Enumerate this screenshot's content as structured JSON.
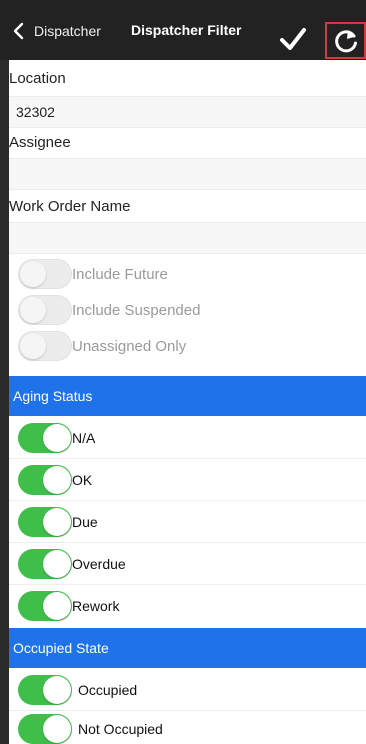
{
  "header": {
    "back_label": "Dispatcher",
    "title": "Dispatcher Filter"
  },
  "form": {
    "location": {
      "label": "Location",
      "value": "32302"
    },
    "assignee": {
      "label": "Assignee",
      "value": ""
    },
    "work_order_name": {
      "label": "Work Order Name",
      "value": ""
    }
  },
  "options": [
    {
      "label": "Include Future",
      "on": false
    },
    {
      "label": "Include Suspended",
      "on": false
    },
    {
      "label": "Unassigned Only",
      "on": false
    }
  ],
  "aging_status": {
    "title": "Aging Status",
    "items": [
      {
        "label": "N/A",
        "on": true
      },
      {
        "label": "OK",
        "on": true
      },
      {
        "label": "Due",
        "on": true
      },
      {
        "label": "Overdue",
        "on": true
      },
      {
        "label": "Rework",
        "on": true
      }
    ]
  },
  "occupied_state": {
    "title": "Occupied State",
    "items": [
      {
        "label": "Occupied",
        "on": true
      },
      {
        "label": "Not Occupied",
        "on": true
      }
    ]
  },
  "colors": {
    "section_blue": "#1f72e8",
    "toggle_green": "#3fbf4a",
    "topbar": "#222222",
    "highlight_red": "#d9363e"
  },
  "icons": {
    "back": "chevron-left-icon",
    "apply": "checkmark-icon",
    "reset": "refresh-icon"
  }
}
